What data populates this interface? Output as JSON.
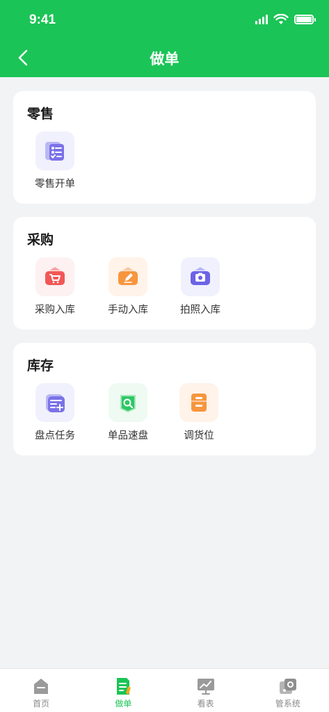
{
  "status_bar": {
    "time": "9:41"
  },
  "nav": {
    "title": "做单"
  },
  "colors": {
    "brand_green": "#1bc456",
    "background": "#f2f3f5"
  },
  "sections": [
    {
      "title": "零售",
      "items": [
        {
          "label": "零售开单",
          "icon": "retail-order-icon"
        }
      ]
    },
    {
      "title": "采购",
      "items": [
        {
          "label": "采购入库",
          "icon": "purchase-inbound-icon"
        },
        {
          "label": "手动入库",
          "icon": "manual-inbound-icon"
        },
        {
          "label": "拍照入库",
          "icon": "photo-inbound-icon"
        }
      ]
    },
    {
      "title": "库存",
      "items": [
        {
          "label": "盘点任务",
          "icon": "stocktake-task-icon"
        },
        {
          "label": "单品速盘",
          "icon": "quick-count-icon"
        },
        {
          "label": "调货位",
          "icon": "transfer-location-icon"
        }
      ]
    }
  ],
  "tabbar": [
    {
      "label": "首页",
      "icon": "home-icon",
      "active": false
    },
    {
      "label": "做单",
      "icon": "orders-icon",
      "active": true
    },
    {
      "label": "看表",
      "icon": "reports-icon",
      "active": false
    },
    {
      "label": "管系统",
      "icon": "system-settings-icon",
      "active": false
    }
  ]
}
